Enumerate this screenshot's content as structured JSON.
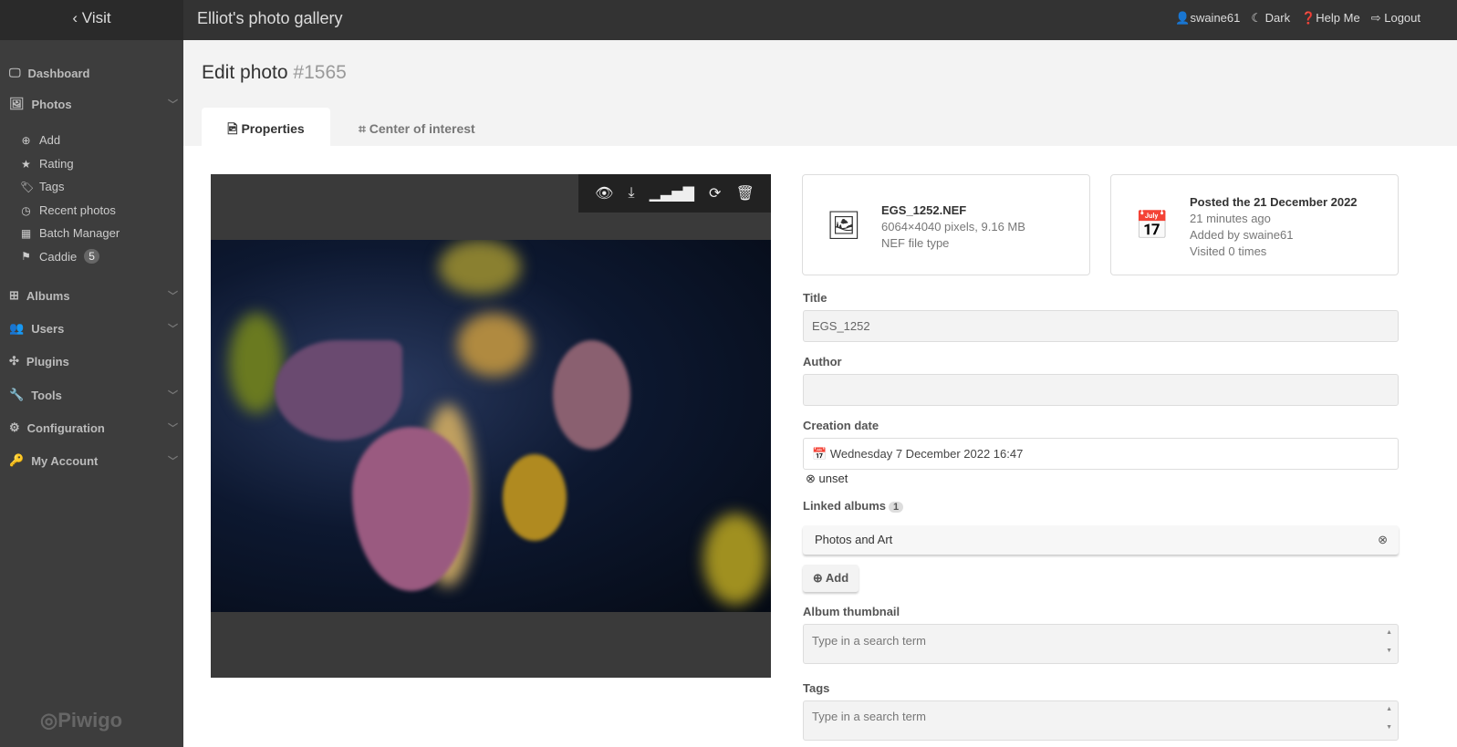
{
  "header": {
    "visit": "Visit",
    "gallery_title": "Elliot's photo gallery",
    "user": "swaine61",
    "dark": "Dark",
    "help": "Help Me",
    "logout": "Logout"
  },
  "sidebar": {
    "menus": [
      {
        "label": "Dashboard"
      },
      {
        "label": "Photos"
      },
      {
        "label": "Albums"
      },
      {
        "label": "Users"
      },
      {
        "label": "Plugins"
      },
      {
        "label": "Tools"
      },
      {
        "label": "Configuration"
      },
      {
        "label": "My Account"
      }
    ],
    "photo_sub": [
      {
        "label": "Add"
      },
      {
        "label": "Rating"
      },
      {
        "label": "Tags"
      },
      {
        "label": "Recent photos"
      },
      {
        "label": "Batch Manager"
      },
      {
        "label": "Caddie",
        "badge": "5"
      }
    ],
    "logo": "Piwigo"
  },
  "page": {
    "title": "Edit photo",
    "id": "#1565",
    "tabs": [
      {
        "label": "Properties"
      },
      {
        "label": "Center of interest"
      }
    ]
  },
  "file_card": {
    "name": "EGS_1252.NEF",
    "dims": "6064×4040 pixels, 9.16 MB",
    "type": "NEF file type"
  },
  "date_card": {
    "posted": "Posted the 21 December 2022",
    "ago": "21 minutes ago",
    "added": "Added by swaine61",
    "visited": "Visited 0 times"
  },
  "form": {
    "title_label": "Title",
    "title_value": "EGS_1252",
    "author_label": "Author",
    "author_value": "",
    "date_label": "Creation date",
    "date_value": "Wednesday 7 December 2022 16:47",
    "unset": "unset",
    "albums_label": "Linked albums",
    "albums_count": "1",
    "albums": [
      "Photos and Art"
    ],
    "add": "Add",
    "thumb_label": "Album thumbnail",
    "thumb_placeholder": "Type in a search term",
    "tags_label": "Tags",
    "tags_placeholder": "Type in a search term"
  }
}
